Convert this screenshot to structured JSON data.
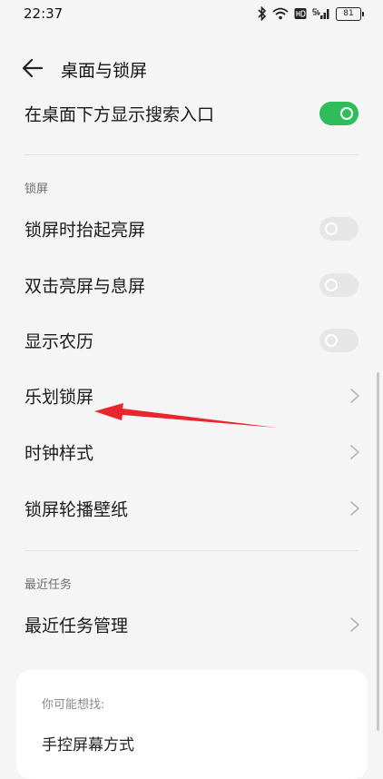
{
  "status_bar": {
    "time": "22:37",
    "battery": "81",
    "icons": [
      "bluetooth-icon",
      "wifi-icon",
      "hd-icon",
      "5g-signal-icon",
      "battery-icon"
    ]
  },
  "header": {
    "title": "桌面与锁屏"
  },
  "settings": {
    "search_entry": {
      "label": "在桌面下方显示搜索入口",
      "enabled": true
    },
    "lock_screen_section": "锁屏",
    "raise_to_wake": {
      "label": "锁屏时抬起亮屏",
      "enabled": false
    },
    "double_tap": {
      "label": "双击亮屏与息屏",
      "enabled": false
    },
    "lunar_calendar": {
      "label": "显示农历",
      "enabled": false
    },
    "lehua_lockscreen": {
      "label": "乐划锁屏"
    },
    "clock_style": {
      "label": "时钟样式"
    },
    "wallpaper_carousel": {
      "label": "锁屏轮播壁纸"
    },
    "recent_tasks_section": "最近任务",
    "recent_tasks_management": {
      "label": "最近任务管理"
    }
  },
  "suggestions": {
    "title": "你可能想找:",
    "items": [
      "手控屏幕方式"
    ]
  },
  "colors": {
    "toggle_on": "#2fbd5b",
    "toggle_off": "#e6e6e6",
    "annotation_arrow": "#e8262b"
  }
}
